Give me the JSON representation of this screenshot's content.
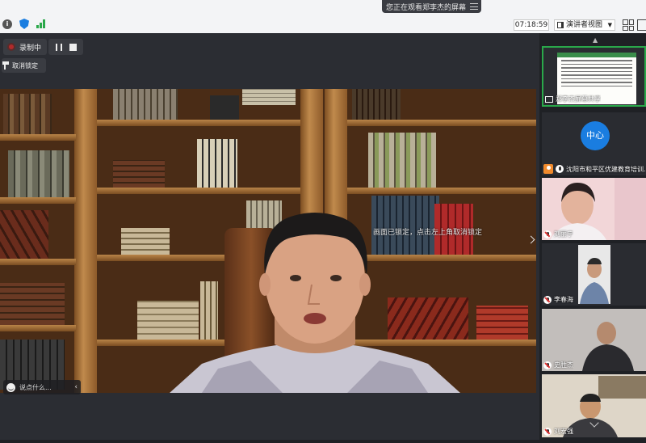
{
  "banner": {
    "text": "您正在观看郑李杰的屏幕"
  },
  "toolbar": {
    "timer": "07:18:59",
    "view_mode": "演讲者视图"
  },
  "recording": {
    "label": "录制中",
    "unlock_label": "取消锁定"
  },
  "video": {
    "lock_tip": "画面已锁定，点击左上角取消锁定"
  },
  "chat": {
    "placeholder": "说点什么..."
  },
  "participants": [
    {
      "name": "郑李杰屏幕共享"
    },
    {
      "name": "沈阳市和平区优建教育培训...",
      "avatar_text": "中心"
    },
    {
      "name": "刘丽宁"
    },
    {
      "name": "李春海"
    },
    {
      "name": "史胜杰"
    },
    {
      "name": "刘宏强"
    }
  ],
  "colors": {
    "accent": "#1a7de0",
    "record": "#b02a2a",
    "active_border": "#2aa84a"
  }
}
